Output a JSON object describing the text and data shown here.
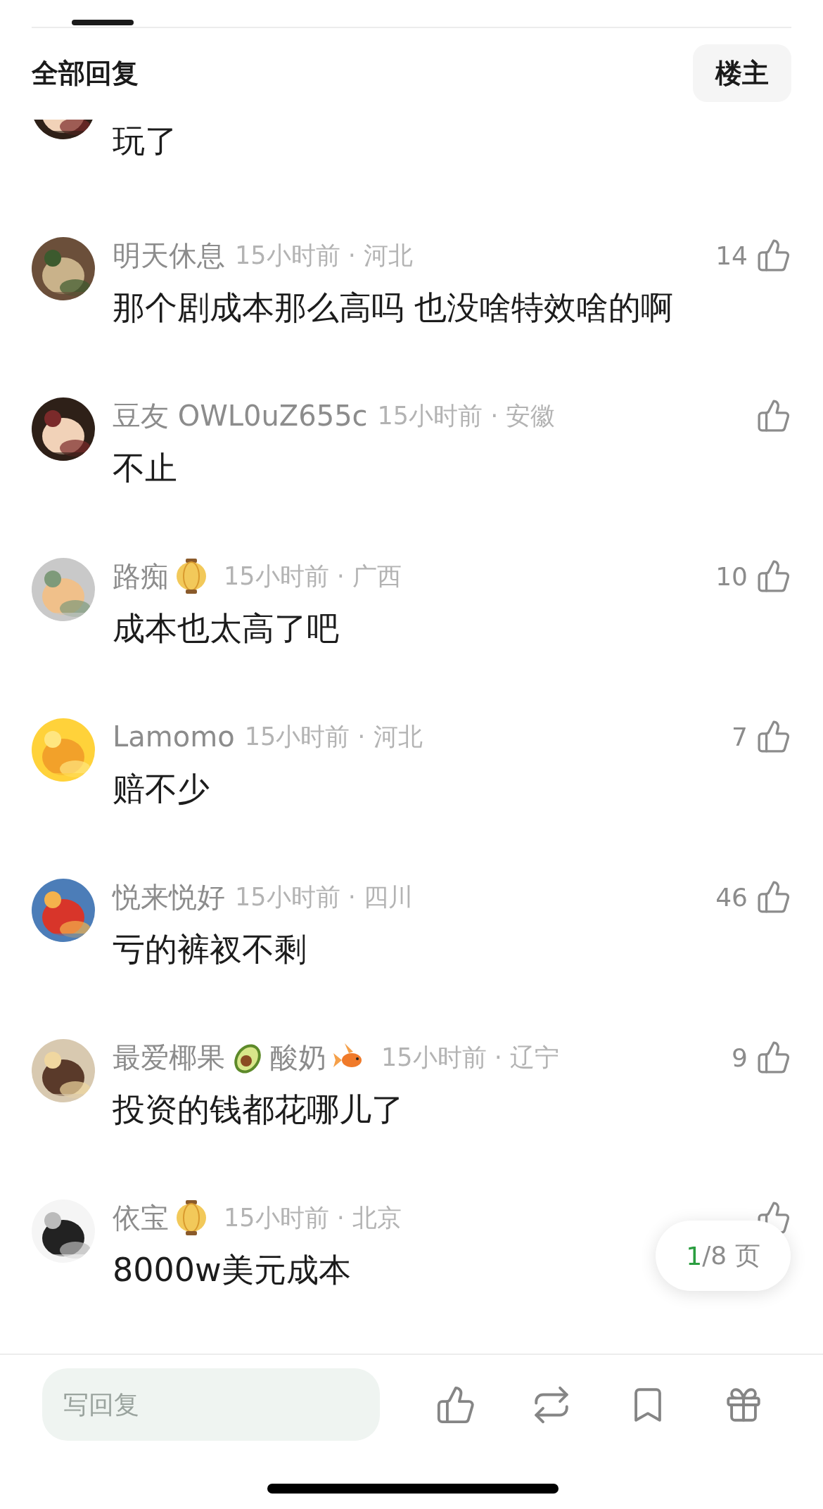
{
  "header": {
    "title": "全部回复",
    "filter_button": "楼主"
  },
  "partial_comment": {
    "content": "玩了"
  },
  "comments": [
    {
      "name_parts": [
        {
          "kind": "text",
          "text": "明天休息"
        }
      ],
      "meta": "15小时前 · 河北",
      "likes": "14",
      "content": "那个剧成本那么高吗 也没啥特效啥的啊"
    },
    {
      "name_parts": [
        {
          "kind": "text",
          "text": "豆友 OWL0uZ655c"
        }
      ],
      "meta": "15小时前 · 安徽",
      "content": "不止"
    },
    {
      "name_parts": [
        {
          "kind": "text",
          "text": "路痴"
        },
        {
          "kind": "lantern"
        }
      ],
      "meta": "15小时前 · 广西",
      "likes": "10",
      "content": "成本也太高了吧"
    },
    {
      "name_parts": [
        {
          "kind": "text",
          "text": "Lamomo"
        }
      ],
      "meta": "15小时前 · 河北",
      "likes": "7",
      "content": "赔不少"
    },
    {
      "name_parts": [
        {
          "kind": "text",
          "text": "悦来悦好"
        }
      ],
      "meta": "15小时前 · 四川",
      "likes": "46",
      "content": "亏的裤衩不剩"
    },
    {
      "name_parts": [
        {
          "kind": "text",
          "text": "最爱椰果"
        },
        {
          "kind": "avocado"
        },
        {
          "kind": "text",
          "text": "酸奶"
        },
        {
          "kind": "fish"
        }
      ],
      "meta": "15小时前 · 辽宁",
      "likes": "9",
      "content": "投资的钱都花哪儿了"
    },
    {
      "name_parts": [
        {
          "kind": "text",
          "text": "依宝"
        },
        {
          "kind": "lantern"
        }
      ],
      "meta": "15小时前 · 北京",
      "content": "8000w美元成本"
    }
  ],
  "pager": {
    "current": "1",
    "total": "/8 页"
  },
  "reply_bar": {
    "placeholder": "写回复"
  }
}
